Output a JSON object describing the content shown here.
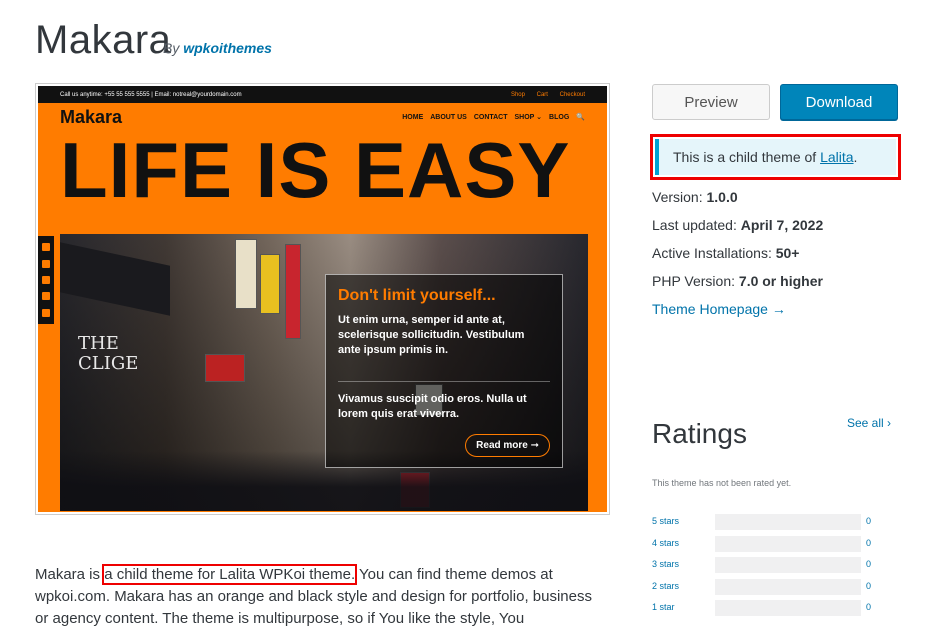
{
  "header": {
    "title": "Makara",
    "by": "By",
    "author": "wpkoithemes"
  },
  "screenshot": {
    "topbar_left": "Call us anytime: +55 55 555 5555 |  Email: notreal@yourdomain.com",
    "topbar_links": [
      "Shop",
      "Cart",
      "Checkout"
    ],
    "brand": "Makara",
    "nav": [
      "HOME",
      "ABOUT US",
      "CONTACT",
      "SHOP ⌄",
      "BLOG"
    ],
    "search_icon": "🔍",
    "hero": "LIFE IS EASY",
    "overlay_title": "Don't limit yourself...",
    "overlay_text": "Ut enim urna, semper id ante at, scelerisque sollicitudin. Vestibulum ante ipsum primis in.",
    "overlay_text2": "Vivamus suscipit odio eros. Nulla ut lorem quis erat viverra.",
    "read_more": "Read more ➞",
    "shop_text": "THE\nCLIGE"
  },
  "description": {
    "prefix": "Makara is ",
    "highlight": "a child theme for Lalita WPKoi theme.",
    "rest": " You can find theme demos at wpkoi.com. Makara has an orange and black style and design for portfolio, business or agency content. The theme is multipurpose, so if You like the style, You"
  },
  "sidebar": {
    "preview": "Preview",
    "download": "Download",
    "notice_prefix": "This is a child theme of ",
    "notice_link": "Lalita",
    "notice_suffix": ".",
    "version_label": "Version: ",
    "version": "1.0.0",
    "updated_label": "Last updated: ",
    "updated": "April 7, 2022",
    "installs_label": "Active Installations: ",
    "installs": "50+",
    "php_label": "PHP Version: ",
    "php": "7.0 or higher",
    "theme_homepage": "Theme Homepage →",
    "ratings_title": "Ratings",
    "see_all": "See all ›",
    "not_rated": "This theme has not been rated yet.",
    "ratings": [
      {
        "label": "5 stars",
        "count": "0"
      },
      {
        "label": "4 stars",
        "count": "0"
      },
      {
        "label": "3 stars",
        "count": "0"
      },
      {
        "label": "2 stars",
        "count": "0"
      },
      {
        "label": "1 star",
        "count": "0"
      }
    ]
  }
}
